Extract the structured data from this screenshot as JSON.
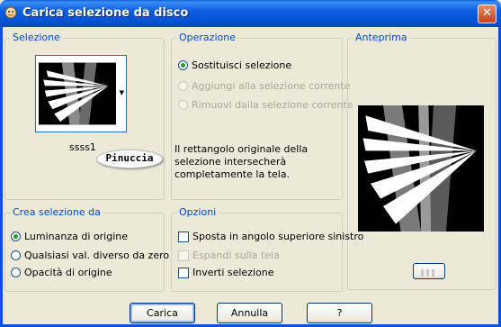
{
  "window": {
    "title": "Carica selezione da disco",
    "close_glyph": "✕"
  },
  "selezione": {
    "title": "Selezione",
    "file_name": "ssss1",
    "watermark_text": "Pinuccia"
  },
  "operazione": {
    "title": "Operazione",
    "options": [
      {
        "label": "Sostituisci selezione",
        "checked": true,
        "disabled": false
      },
      {
        "label": "Aggiungi alla selezione corrente",
        "checked": false,
        "disabled": true
      },
      {
        "label": "Rimuovi dalla selezione corrente",
        "checked": false,
        "disabled": true
      }
    ],
    "info_text": "Il rettangolo originale della selezione intersecherà completamente la tela."
  },
  "anteprima": {
    "title": "Anteprima"
  },
  "crea": {
    "title": "Crea selezione da",
    "options": [
      {
        "label": "Luminanza di origine",
        "checked": true
      },
      {
        "label": "Qualsiasi val. diverso da zero",
        "checked": false
      },
      {
        "label": "Opacità di origine",
        "checked": false
      }
    ]
  },
  "opzioni": {
    "title": "Opzioni",
    "options": [
      {
        "label": "Sposta in angolo superiore sinistro",
        "checked": false,
        "disabled": false
      },
      {
        "label": "Espandi sulla tela",
        "checked": false,
        "disabled": true
      },
      {
        "label": "Inverti selezione",
        "checked": false,
        "disabled": false
      }
    ]
  },
  "buttons": {
    "load": "Carica",
    "cancel": "Annulla",
    "help": "?"
  },
  "colors": {
    "title_bar": "#0a5fd8",
    "group_title": "#0046d5",
    "radio_dot": "#21a121"
  }
}
